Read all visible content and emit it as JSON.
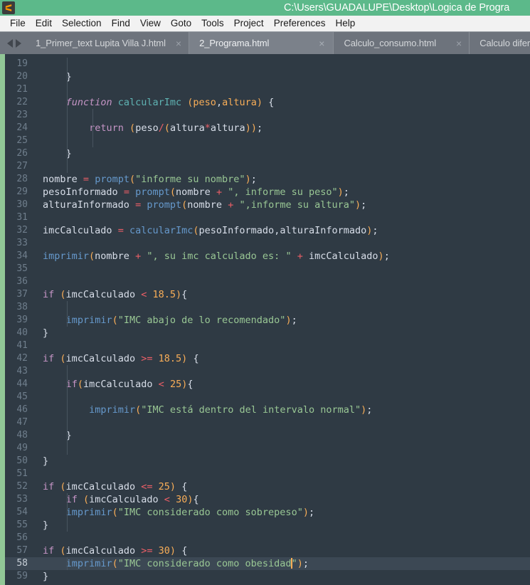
{
  "window": {
    "title": "C:\\Users\\GUADALUPE\\Desktop\\Logica de Progra",
    "logo_icon": "sublime-text-logo-icon",
    "titlebar_color": "#5cb98a"
  },
  "menubar": {
    "items": [
      {
        "label": "File"
      },
      {
        "label": "Edit"
      },
      {
        "label": "Selection"
      },
      {
        "label": "Find"
      },
      {
        "label": "View"
      },
      {
        "label": "Goto"
      },
      {
        "label": "Tools"
      },
      {
        "label": "Project"
      },
      {
        "label": "Preferences"
      },
      {
        "label": "Help"
      }
    ]
  },
  "tabbar": {
    "nav_prev_icon": "arrow-left-icon",
    "nav_next_icon": "arrow-right-icon",
    "close_glyph": "×",
    "tabs": [
      {
        "label": "1_Primer_text Lupita Villa J.html",
        "active": false
      },
      {
        "label": "2_Programa.html",
        "active": true
      },
      {
        "label": "Calculo_consumo.html",
        "active": false
      },
      {
        "label": "Calculo diferencia de edades.htm",
        "active": false
      }
    ]
  },
  "editor": {
    "active_line": 58,
    "cursor_color": "#f9ae58",
    "background": "#2f3a44",
    "line_number_color": "#6f7e8c",
    "lines": [
      {
        "n": 19,
        "text": ""
      },
      {
        "n": 20,
        "text": "    }"
      },
      {
        "n": 21,
        "text": ""
      },
      {
        "n": 22,
        "text": "    function calcularImc (peso,altura) {"
      },
      {
        "n": 23,
        "text": ""
      },
      {
        "n": 24,
        "text": "        return (peso/(altura*altura));"
      },
      {
        "n": 25,
        "text": ""
      },
      {
        "n": 26,
        "text": "    }"
      },
      {
        "n": 27,
        "text": ""
      },
      {
        "n": 28,
        "text": "nombre = prompt(\"informe su nombre\");"
      },
      {
        "n": 29,
        "text": "pesoInformado = prompt(nombre + \", informe su peso\");"
      },
      {
        "n": 30,
        "text": "alturaInformado = prompt(nombre + \",informe su altura\");"
      },
      {
        "n": 31,
        "text": ""
      },
      {
        "n": 32,
        "text": "imcCalculado = calcularImc(pesoInformado,alturaInformado);"
      },
      {
        "n": 33,
        "text": ""
      },
      {
        "n": 34,
        "text": "imprimir(nombre + \", su imc calculado es: \" + imcCalculado);"
      },
      {
        "n": 35,
        "text": ""
      },
      {
        "n": 36,
        "text": ""
      },
      {
        "n": 37,
        "text": "if (imcCalculado < 18.5){"
      },
      {
        "n": 38,
        "text": ""
      },
      {
        "n": 39,
        "text": "    imprimir(\"IMC abajo de lo recomendado\");"
      },
      {
        "n": 40,
        "text": "}"
      },
      {
        "n": 41,
        "text": ""
      },
      {
        "n": 42,
        "text": "if (imcCalculado >= 18.5) {"
      },
      {
        "n": 43,
        "text": ""
      },
      {
        "n": 44,
        "text": "    if(imcCalculado < 25){"
      },
      {
        "n": 45,
        "text": ""
      },
      {
        "n": 46,
        "text": "        imprimir(\"IMC está dentro del intervalo normal\");"
      },
      {
        "n": 47,
        "text": ""
      },
      {
        "n": 48,
        "text": "    }"
      },
      {
        "n": 49,
        "text": ""
      },
      {
        "n": 50,
        "text": "}"
      },
      {
        "n": 51,
        "text": ""
      },
      {
        "n": 52,
        "text": "if (imcCalculado <= 25) {"
      },
      {
        "n": 53,
        "text": "    if (imcCalculado < 30){"
      },
      {
        "n": 54,
        "text": "    imprimir(\"IMC considerado como sobrepeso\");"
      },
      {
        "n": 55,
        "text": "}"
      },
      {
        "n": 56,
        "text": ""
      },
      {
        "n": 57,
        "text": "if (imcCalculado >= 30) {"
      },
      {
        "n": 58,
        "text": "    imprimir(\"IMC considerado como obesidad\");"
      },
      {
        "n": 59,
        "text": "}"
      }
    ]
  }
}
